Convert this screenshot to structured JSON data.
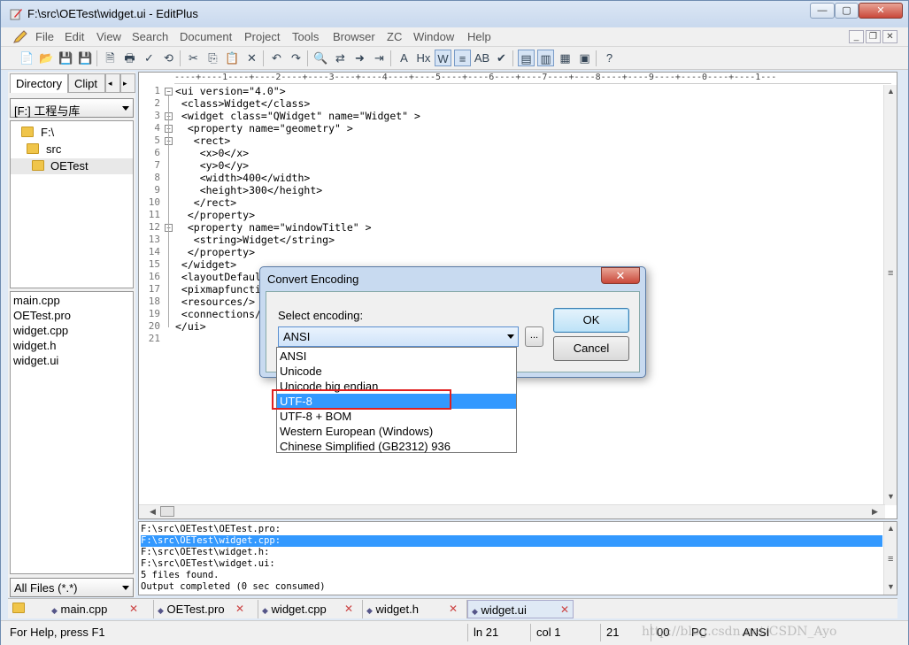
{
  "window": {
    "title": "F:\\src\\OETest\\widget.ui - EditPlus",
    "min": "—",
    "max": "▢",
    "close": "✕"
  },
  "menu": [
    "File",
    "Edit",
    "View",
    "Search",
    "Document",
    "Project",
    "Tools",
    "Browser",
    "ZC",
    "Window",
    "Help"
  ],
  "mdi": {
    "min": "_",
    "restore": "❐",
    "close": "✕"
  },
  "toolbar": {
    "icons": [
      "new-icon",
      "open-icon",
      "save-icon",
      "save-all-icon",
      "print-preview-icon",
      "print-icon",
      "spellcheck-icon",
      "sync-icon",
      "cut-icon",
      "copy-icon",
      "paste-icon",
      "delete-icon",
      "undo-icon",
      "redo-icon",
      "find-icon",
      "replace-icon",
      "goto-icon",
      "indent-icon",
      "font-icon",
      "hex-icon",
      "word-wrap-icon",
      "line-number-icon",
      "column-select-icon",
      "check-icon",
      "sidebar-icon",
      "output-icon",
      "browser-icon",
      "fullscreen-icon",
      "help-icon"
    ],
    "glyphs": [
      "📄",
      "📂",
      "💾",
      "💾",
      "🗎",
      "🖶",
      "✓",
      "⟲",
      "✂",
      "⎘",
      "📋",
      "✕",
      "↶",
      "↷",
      "🔍",
      "⇄",
      "➜",
      "⇥",
      "A",
      "Hx",
      "W",
      "≡",
      "AB",
      "✔",
      "▤",
      "▥",
      "▦",
      "▣",
      "?"
    ]
  },
  "sidebar": {
    "tabs": [
      "Directory",
      "Clipt"
    ],
    "tab_nav": [
      "◂",
      "▸"
    ],
    "drive": "[F:] 工程与库",
    "tree": [
      "F:\\",
      "src",
      "OETest"
    ],
    "files": [
      "main.cpp",
      "OETest.pro",
      "widget.cpp",
      "widget.h",
      "widget.ui"
    ],
    "filter": "All Files (*.*)"
  },
  "editor": {
    "ruler": "----+----1----+----2----+----3----+----4----+----5----+----6----+----7----+----8----+----9----+----0----+----1---",
    "lines": [
      "<ui version=\"4.0\">",
      " <class>Widget</class>",
      " <widget class=\"QWidget\" name=\"Widget\" >",
      "  <property name=\"geometry\" >",
      "   <rect>",
      "    <x>0</x>",
      "    <y>0</y>",
      "    <width>400</width>",
      "    <height>300</height>",
      "   </rect>",
      "  </property>",
      "  <property name=\"windowTitle\" >",
      "   <string>Widget</string>",
      "  </property>",
      " </widget>",
      " <layoutDefaul",
      " <pixmapfuncti",
      " <resources/>",
      " <connections/",
      "</ui>",
      ""
    ],
    "line_numbers": [
      "1",
      "2",
      "3",
      "4",
      "5",
      "6",
      "7",
      "8",
      "9",
      "10",
      "11",
      "12",
      "13",
      "14",
      "15",
      "16",
      "17",
      "18",
      "19",
      "20",
      "21"
    ]
  },
  "output": {
    "lines": [
      "F:\\src\\OETest\\OETest.pro:",
      "F:\\src\\OETest\\widget.cpp:",
      "F:\\src\\OETest\\widget.h:",
      "F:\\src\\OETest\\widget.ui:",
      "5 files found.",
      "Output completed (0 sec consumed)"
    ],
    "selected_index": 1
  },
  "tabs": [
    "main.cpp",
    "OETest.pro",
    "widget.cpp",
    "widget.h",
    "widget.ui"
  ],
  "active_tab": "widget.ui",
  "status": {
    "help": "For Help, press F1",
    "line": "ln 21",
    "col": "col 1",
    "count": "21",
    "zero": "00",
    "mode": "PC",
    "encoding": "ANSI",
    "watermark": "http://blog.csdn.net/CSDN_Ayo"
  },
  "dialog": {
    "title": "Convert Encoding",
    "close": "✕",
    "label": "Select encoding:",
    "selected": "ANSI",
    "dots": "...",
    "ok": "OK",
    "cancel": "Cancel",
    "options": [
      "ANSI",
      "Unicode",
      "Unicode big endian",
      "UTF-8",
      "UTF-8 + BOM",
      "Western European (Windows)",
      "Chinese Simplified (GB2312) 936"
    ],
    "highlighted": "UTF-8"
  },
  "colors": {
    "selection": "#3399ff",
    "highlight_box": "#e02020",
    "title_bar": "#c9d9ee"
  }
}
